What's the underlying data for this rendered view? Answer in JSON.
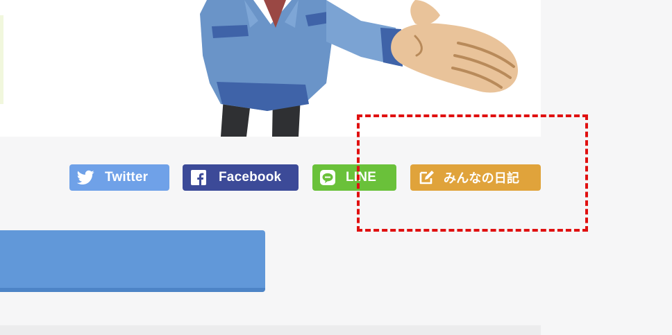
{
  "hero": {
    "illustration": "worker-character-pointing"
  },
  "share": {
    "twitter": {
      "label": "Twitter",
      "icon": "twitter-bird-icon",
      "color": "#6fa1e8"
    },
    "facebook": {
      "label": "Facebook",
      "icon": "facebook-f-icon",
      "color": "#3c4a98"
    },
    "line": {
      "label": "LINE",
      "icon": "line-chat-icon",
      "color": "#6ac13a"
    },
    "diary": {
      "label": "みんなの日記",
      "icon": "edit-note-icon",
      "color": "#e0a33b"
    }
  },
  "highlight": {
    "color": "#e01010",
    "style": "dashed"
  },
  "accent_bar": {
    "color": "#6198d9"
  }
}
